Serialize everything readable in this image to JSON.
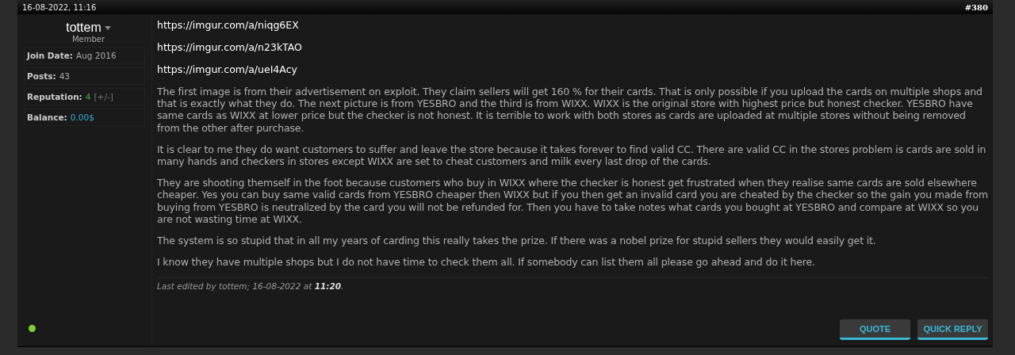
{
  "post": {
    "date": "16-08-2022, 11:16",
    "number": "#380"
  },
  "author": {
    "name": "tottem",
    "rank": "Member",
    "online": true,
    "stats": [
      {
        "label": "Join Date:",
        "value": "Aug 2016",
        "kind": "plain"
      },
      {
        "label": "Posts:",
        "value": "43",
        "kind": "plain"
      },
      {
        "label": "Reputation:",
        "value": "4",
        "extra": "[+/-]",
        "kind": "reputation"
      },
      {
        "label": "Balance:",
        "value": "0.00$",
        "kind": "link"
      }
    ]
  },
  "links": [
    "https://imgur.com/a/niqg6EX",
    "https://imgur.com/a/n23kTAO",
    "https://imgur.com/a/ueI4Acy"
  ],
  "paragraphs": [
    "The first image is from their advertisement on exploit. They claim sellers will get 160 % for their cards. That is only possible if you upload the cards on multiple shops and that is exactly what they do. The next picture is from YESBRO and the third is from WIXX. WIXX is the original store with highest price but honest checker. YESBRO have same cards as WIXX at lower price but the checker is not honest. It is terrible to work with both stores as cards are uploaded at multiple stores without being removed from the other after purchase.",
    "It is clear to me they do want customers to suffer and leave the store because it takes forever to find valid CC. There are valid CC in the stores problem is cards are sold in many hands and checkers in stores except WIXX are set to cheat customers and milk every last drop of the cards.",
    "They are shooting themself in the foot because customers who buy in WIXX where the checker is honest get frustrated when they realise same cards are sold elsewhere cheaper. Yes you can buy same valid cards from YESBRO cheaper then WIXX but if you then get an invalid card you are cheated by the checker so the gain you made from buying from YESBRO is neutralized by the card you will not be refunded for. Then you have to take notes what cards you bought at YESBRO and compare at WIXX so you are not wasting time at WIXX.",
    "The system is so stupid that in all my years of carding this really takes the prize. If there was a nobel prize for stupid sellers they would easily get it.",
    "I know they have multiple shops but I do not have time to check them all. If somebody can list them all please go ahead and do it here."
  ],
  "edit_note": "Last edited by tottem; 16-08-2022 at **11:20**.",
  "buttons": [
    "QUOTE",
    "QUICK REPLY"
  ]
}
